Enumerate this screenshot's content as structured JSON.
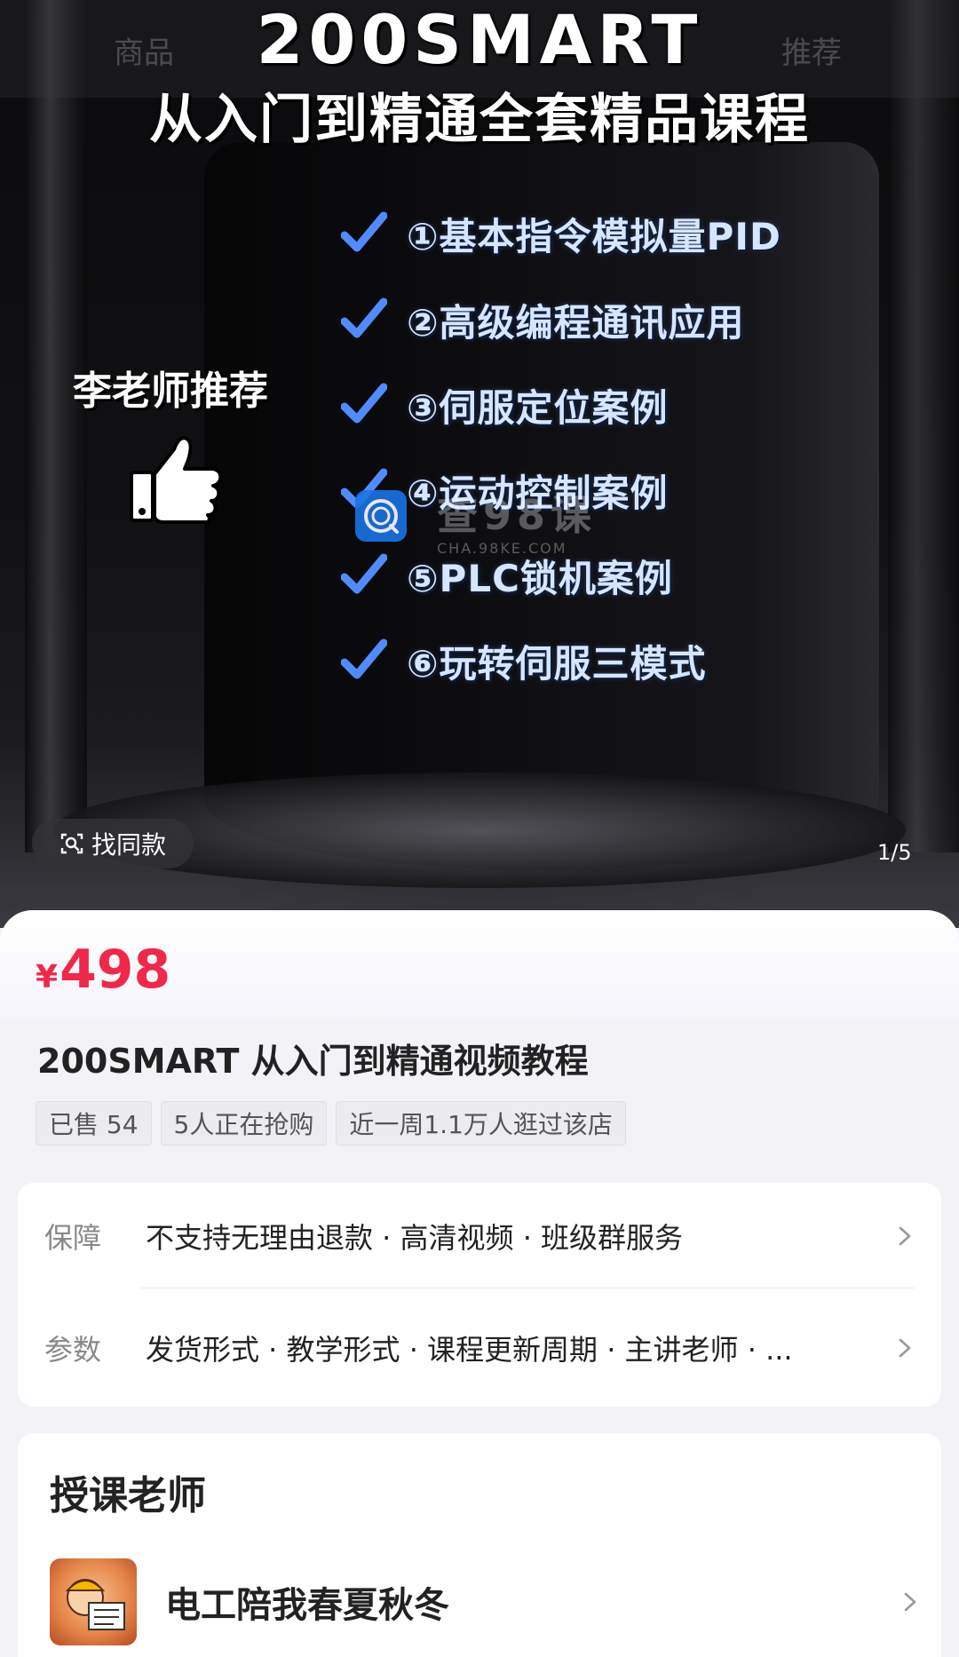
{
  "nav": {
    "tab_goods": "商品",
    "tab_recommend": "推荐"
  },
  "hero": {
    "title_line1": "200SMART",
    "title_line2": "从入门到精通全套精品课程",
    "teacher_recommend": "李老师推荐",
    "features": [
      "①基本指令模拟量PID",
      "②高级编程通讯应用",
      "③伺服定位案例",
      "④运动控制案例",
      "⑤PLC锁机案例",
      "⑥玩转伺服三模式"
    ],
    "watermark_text": "查98课",
    "watermark_sub": "CHA.98KE.COM",
    "find_same_label": "找同款",
    "pager": "1/5"
  },
  "product": {
    "price_symbol": "¥",
    "price_value": "498",
    "title": "200SMART 从入门到精通视频教程",
    "tags": [
      "已售 54",
      "5人正在抢购",
      "近一周1.1万人逛过该店"
    ]
  },
  "info": {
    "guarantee_label": "保障",
    "guarantee_value": "不支持无理由退款 · 高清视频 · 班级群服务",
    "params_label": "参数",
    "params_value": "发货形式 · 教学形式 · 课程更新周期 · 主讲老师 · ..."
  },
  "teacher": {
    "heading": "授课老师",
    "name": "电工陪我春夏秋冬"
  },
  "colors": {
    "price": "#f0284a",
    "feature_text": "#d7e6ff",
    "check": "#4f8cff"
  }
}
